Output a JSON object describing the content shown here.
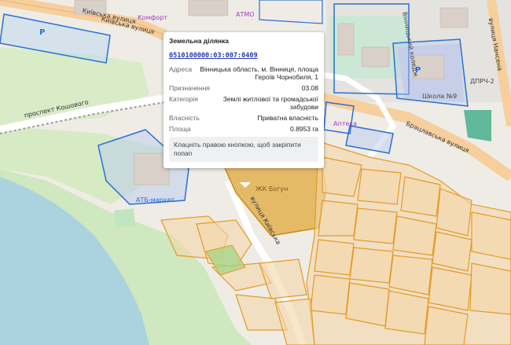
{
  "popup": {
    "title": "Земельна ділянка",
    "cadastral_number": "0510100000:03:007:0409",
    "fields": [
      {
        "label": "Адреса",
        "value": "Вінницька область, м. Вінниця, площа Героїв Чорнобиля, 1"
      },
      {
        "label": "Призначення",
        "value": "03.08"
      },
      {
        "label": "Категорія",
        "value": "Землі житлової та громадської забудови"
      },
      {
        "label": "Власність",
        "value": "Приватна власність"
      },
      {
        "label": "Площа",
        "value": "0.8953 га"
      }
    ],
    "hint": "Клацніть правою кнопкою, щоб закріпити попап"
  },
  "map_labels": {
    "kyivska1": "Київська вулиця",
    "kyivska2": "Київська вулиця",
    "koshovoho": "проспект Кошового",
    "brativ": "Брацлавська вулиця",
    "nahimova": "вулиця Нансена",
    "zhk": "ЖК Богун",
    "karpatska": "вулиця Київська",
    "school": "Школа №9",
    "college": "Вінницький коледж",
    "dprch": "ДПРЧ-2",
    "atb": "АТБ-маркет",
    "komfort": "Комфорт",
    "atmo": "АТМО",
    "pharmacy": "Аптека",
    "parking": "P"
  }
}
